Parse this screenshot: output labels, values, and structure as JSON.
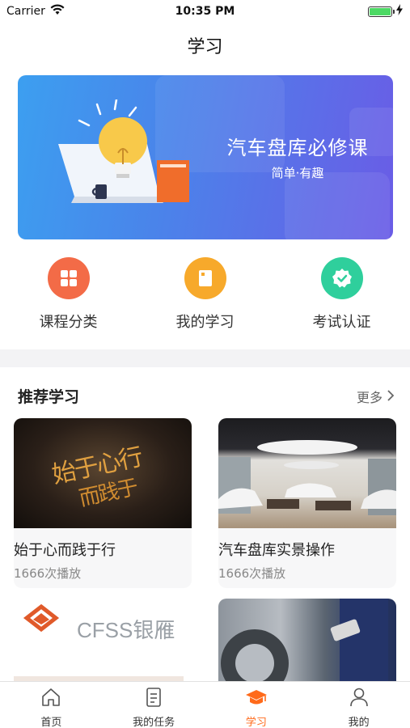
{
  "status_bar": {
    "carrier": "Carrier",
    "time": "10:35 PM"
  },
  "header": {
    "title": "学习"
  },
  "banner": {
    "title": "汽车盘库必修课",
    "subtitle": "简单·有趣"
  },
  "quick_actions": [
    {
      "label": "课程分类",
      "icon": "grid-icon",
      "color": "#f36b47"
    },
    {
      "label": "我的学习",
      "icon": "notebook-icon",
      "color": "#f7a92b"
    },
    {
      "label": "考试认证",
      "icon": "verified-badge-icon",
      "color": "#2fcf9c"
    }
  ],
  "section": {
    "title": "推荐学习",
    "more": "更多"
  },
  "cards": [
    {
      "title": "始于心而践于行",
      "plays": "1666次播放",
      "image_text_1": "始于心行",
      "image_text_2": "而践于"
    },
    {
      "title": "汽车盘库实景操作",
      "plays": "1666次播放"
    },
    {
      "logo_text": "CFSS银雁",
      "partial_title": "Ç..."
    },
    {}
  ],
  "tabbar": {
    "items": [
      {
        "label": "首页",
        "icon": "home-icon"
      },
      {
        "label": "我的任务",
        "icon": "task-list-icon"
      },
      {
        "label": "学习",
        "icon": "graduation-cap-icon",
        "active": true
      },
      {
        "label": "我的",
        "icon": "user-icon"
      }
    ]
  },
  "colors": {
    "accent": "#ff6a1a",
    "banner_start": "#3c9ff0",
    "banner_end": "#6a5ce6"
  }
}
